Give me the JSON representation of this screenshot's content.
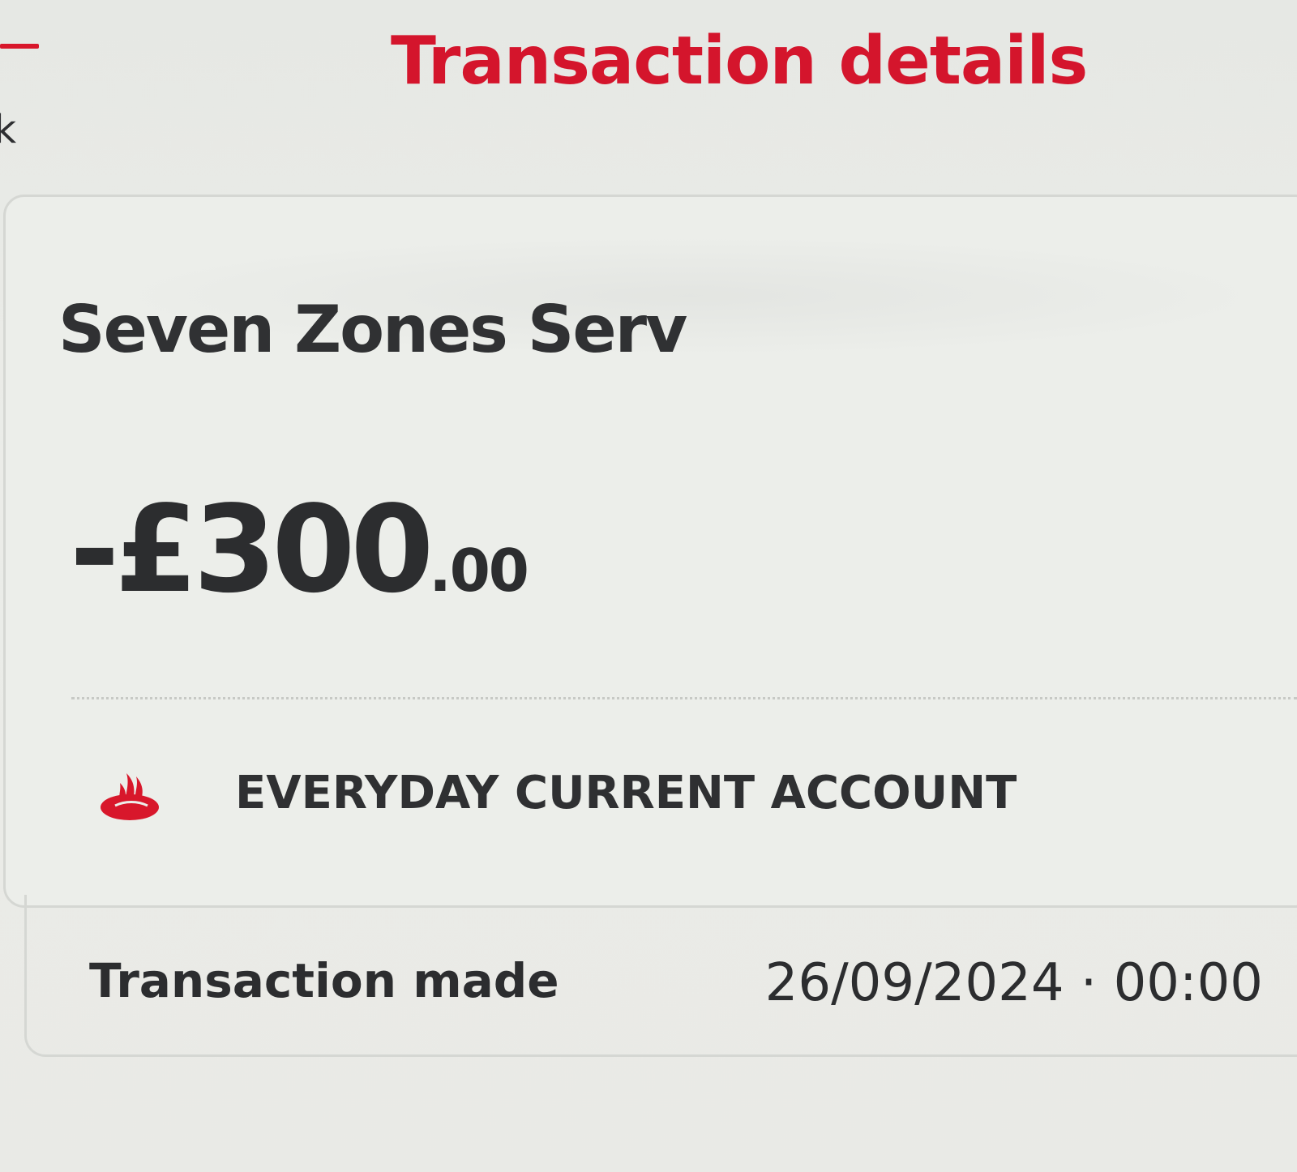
{
  "header": {
    "title": "Transaction details",
    "back_label": "ck"
  },
  "transaction": {
    "merchant": "Seven Zones Serv",
    "amount_main": "-£300",
    "amount_minor": ".00",
    "account_name": "EVERYDAY CURRENT ACCOUNT",
    "account_icon": "bank-flame-icon",
    "detail_label": "Transaction made",
    "detail_value": "26/09/2024 · 00:00"
  },
  "colors": {
    "brand_red": "#d4152c",
    "text_dark": "#2c2d2f",
    "background": "#e9eae6"
  }
}
